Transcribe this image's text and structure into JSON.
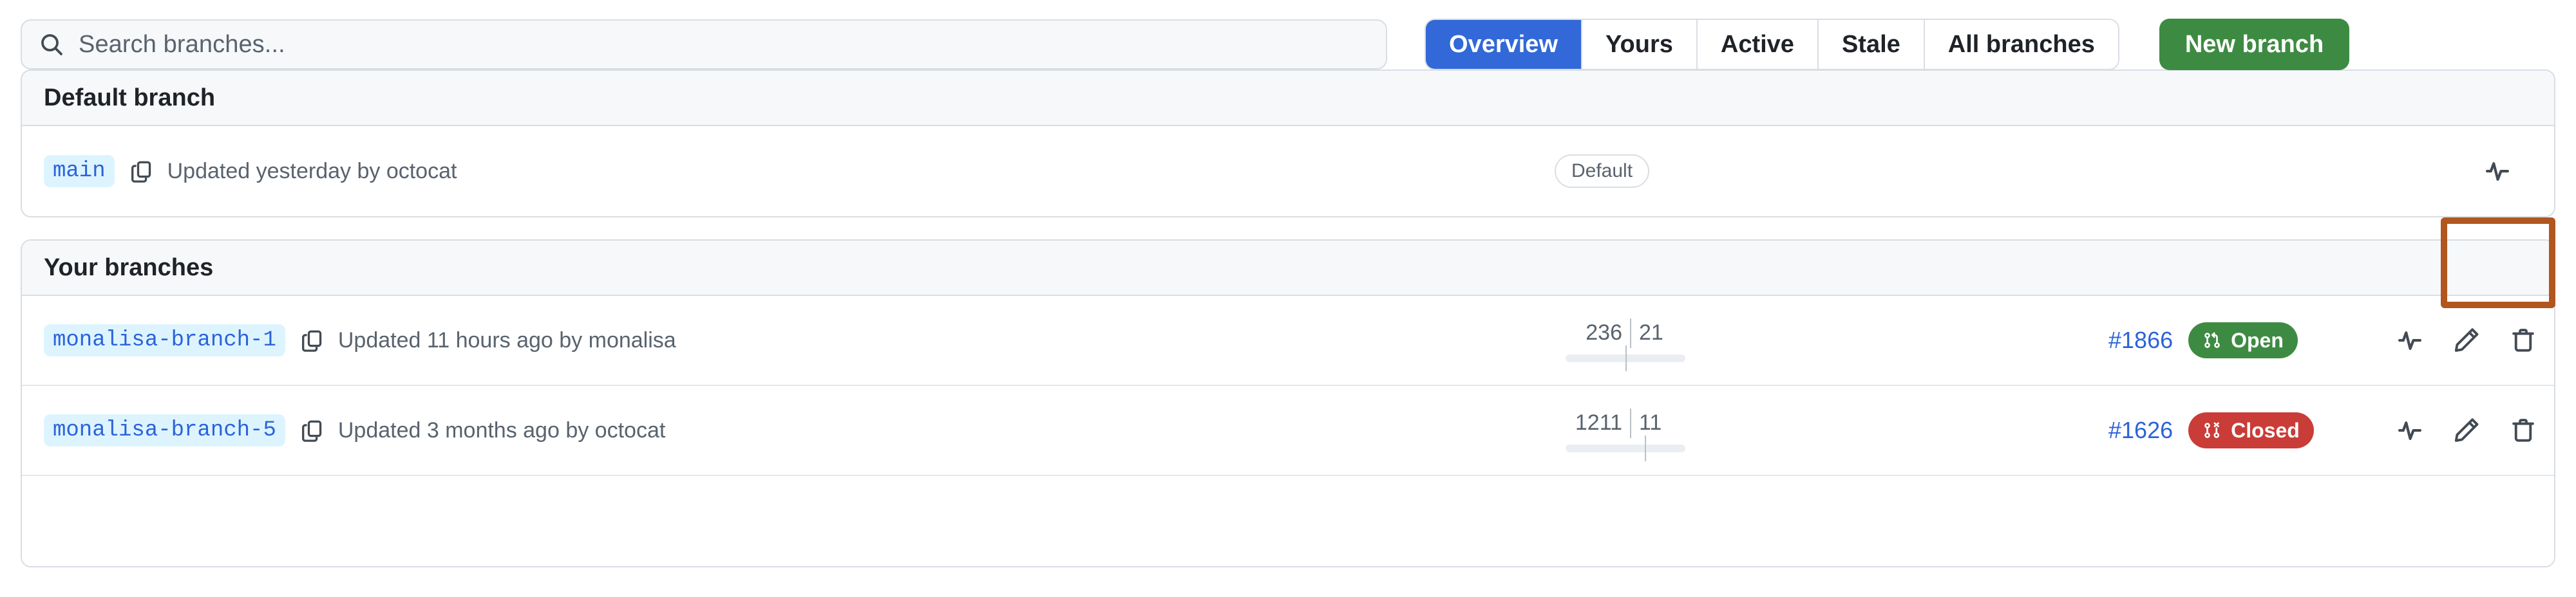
{
  "search": {
    "placeholder": "Search branches...",
    "value": "",
    "icon": "search-icon"
  },
  "tabs": [
    {
      "label": "Overview",
      "active": true
    },
    {
      "label": "Yours",
      "active": false
    },
    {
      "label": "Active",
      "active": false
    },
    {
      "label": "Stale",
      "active": false
    },
    {
      "label": "All branches",
      "active": false
    }
  ],
  "new_branch_button": {
    "label": "New branch"
  },
  "colors": {
    "accent_blue": "#3268d8",
    "link_blue": "#2b63d9",
    "success_green": "#3d8b42",
    "danger_red": "#c93c37",
    "branch_chip_bg": "#ddf4ff",
    "highlight_orange": "#b0561f",
    "border": "#d8dee4",
    "header_bg": "#f6f8fa",
    "muted_text": "#59636e"
  },
  "sections": [
    {
      "id": "default-branch",
      "title": "Default branch",
      "rows": [
        {
          "name": "main",
          "copy_icon": "copy-icon",
          "updated": "Updated yesterday by octocat",
          "badge": "Default",
          "actions": [
            {
              "icon": "pulse-icon",
              "name": "branch-activity-button",
              "highlighted": true
            }
          ]
        }
      ]
    },
    {
      "id": "your-branches",
      "title": "Your branches",
      "rows": [
        {
          "name": "monalisa-branch-1",
          "copy_icon": "copy-icon",
          "updated": "Updated 11 hours ago by monalisa",
          "behind": "236",
          "ahead": "21",
          "pr_number": "#1866",
          "pr_state": "Open",
          "pr_state_kind": "open",
          "pr_state_icon": "git-pull-request-icon",
          "actions": [
            {
              "icon": "pulse-icon",
              "name": "branch-activity-button"
            },
            {
              "icon": "pencil-icon",
              "name": "rename-branch-button"
            },
            {
              "icon": "trash-icon",
              "name": "delete-branch-button"
            }
          ]
        },
        {
          "name": "monalisa-branch-5",
          "copy_icon": "copy-icon",
          "updated": "Updated 3 months ago by octocat",
          "behind": "1211",
          "ahead": "11",
          "pr_number": "#1626",
          "pr_state": "Closed",
          "pr_state_kind": "closed",
          "pr_state_icon": "git-pull-request-closed-icon",
          "actions": [
            {
              "icon": "pulse-icon",
              "name": "branch-activity-button"
            },
            {
              "icon": "pencil-icon",
              "name": "rename-branch-button"
            },
            {
              "icon": "trash-icon",
              "name": "delete-branch-button"
            }
          ]
        },
        {
          "name": "",
          "updated": "",
          "partial": true
        }
      ]
    }
  ]
}
